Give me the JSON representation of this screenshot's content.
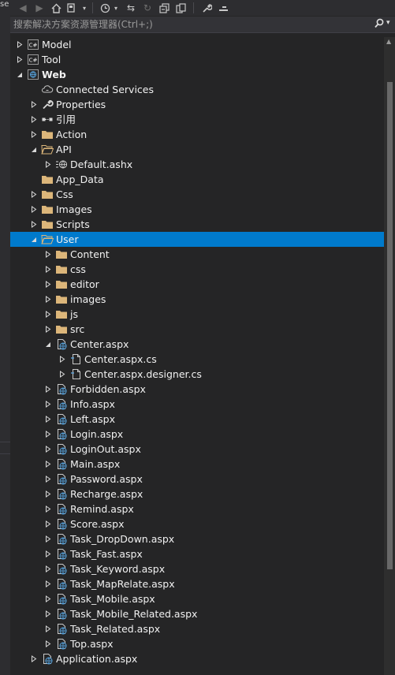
{
  "window": {
    "partial_title": "se"
  },
  "search": {
    "placeholder": "搜索解决方案资源管理器(Ctrl+;)"
  },
  "tree": [
    {
      "label": "Model",
      "depth": 0,
      "icon": "csharp-project",
      "expander": "collapsed",
      "bold": false,
      "selected": false
    },
    {
      "label": "Tool",
      "depth": 0,
      "icon": "csharp-project",
      "expander": "collapsed",
      "bold": false,
      "selected": false
    },
    {
      "label": "Web",
      "depth": 0,
      "icon": "web-project",
      "expander": "expanded",
      "bold": true,
      "selected": false
    },
    {
      "label": "Connected Services",
      "depth": 1,
      "icon": "connected-services",
      "expander": "none",
      "bold": false,
      "selected": false
    },
    {
      "label": "Properties",
      "depth": 1,
      "icon": "wrench",
      "expander": "collapsed",
      "bold": false,
      "selected": false
    },
    {
      "label": "引用",
      "depth": 1,
      "icon": "references",
      "expander": "collapsed",
      "bold": false,
      "selected": false
    },
    {
      "label": "Action",
      "depth": 1,
      "icon": "folder",
      "expander": "collapsed",
      "bold": false,
      "selected": false
    },
    {
      "label": "API",
      "depth": 1,
      "icon": "folder-open",
      "expander": "expanded",
      "bold": false,
      "selected": false
    },
    {
      "label": "Default.ashx",
      "depth": 2,
      "icon": "web-handler",
      "expander": "collapsed",
      "bold": false,
      "selected": false
    },
    {
      "label": "App_Data",
      "depth": 1,
      "icon": "folder",
      "expander": "none",
      "bold": false,
      "selected": false
    },
    {
      "label": "Css",
      "depth": 1,
      "icon": "folder",
      "expander": "collapsed",
      "bold": false,
      "selected": false
    },
    {
      "label": "Images",
      "depth": 1,
      "icon": "folder",
      "expander": "collapsed",
      "bold": false,
      "selected": false
    },
    {
      "label": "Scripts",
      "depth": 1,
      "icon": "folder",
      "expander": "collapsed",
      "bold": false,
      "selected": false
    },
    {
      "label": "User",
      "depth": 1,
      "icon": "folder-open",
      "expander": "expanded",
      "bold": false,
      "selected": true
    },
    {
      "label": "Content",
      "depth": 2,
      "icon": "folder",
      "expander": "collapsed",
      "bold": false,
      "selected": false
    },
    {
      "label": "css",
      "depth": 2,
      "icon": "folder",
      "expander": "collapsed",
      "bold": false,
      "selected": false
    },
    {
      "label": "editor",
      "depth": 2,
      "icon": "folder",
      "expander": "collapsed",
      "bold": false,
      "selected": false
    },
    {
      "label": "images",
      "depth": 2,
      "icon": "folder",
      "expander": "collapsed",
      "bold": false,
      "selected": false
    },
    {
      "label": "js",
      "depth": 2,
      "icon": "folder",
      "expander": "collapsed",
      "bold": false,
      "selected": false
    },
    {
      "label": "src",
      "depth": 2,
      "icon": "folder",
      "expander": "collapsed",
      "bold": false,
      "selected": false
    },
    {
      "label": "Center.aspx",
      "depth": 2,
      "icon": "aspx-page",
      "expander": "expanded",
      "bold": false,
      "selected": false
    },
    {
      "label": "Center.aspx.cs",
      "depth": 3,
      "icon": "code-file",
      "expander": "collapsed",
      "bold": false,
      "selected": false
    },
    {
      "label": "Center.aspx.designer.cs",
      "depth": 3,
      "icon": "code-file",
      "expander": "collapsed",
      "bold": false,
      "selected": false
    },
    {
      "label": "Forbidden.aspx",
      "depth": 2,
      "icon": "aspx-page",
      "expander": "collapsed",
      "bold": false,
      "selected": false
    },
    {
      "label": "Info.aspx",
      "depth": 2,
      "icon": "aspx-page",
      "expander": "collapsed",
      "bold": false,
      "selected": false
    },
    {
      "label": "Left.aspx",
      "depth": 2,
      "icon": "aspx-page",
      "expander": "collapsed",
      "bold": false,
      "selected": false
    },
    {
      "label": "Login.aspx",
      "depth": 2,
      "icon": "aspx-page",
      "expander": "collapsed",
      "bold": false,
      "selected": false
    },
    {
      "label": "LoginOut.aspx",
      "depth": 2,
      "icon": "aspx-page",
      "expander": "collapsed",
      "bold": false,
      "selected": false
    },
    {
      "label": "Main.aspx",
      "depth": 2,
      "icon": "aspx-page",
      "expander": "collapsed",
      "bold": false,
      "selected": false
    },
    {
      "label": "Password.aspx",
      "depth": 2,
      "icon": "aspx-page",
      "expander": "collapsed",
      "bold": false,
      "selected": false
    },
    {
      "label": "Recharge.aspx",
      "depth": 2,
      "icon": "aspx-page",
      "expander": "collapsed",
      "bold": false,
      "selected": false
    },
    {
      "label": "Remind.aspx",
      "depth": 2,
      "icon": "aspx-page",
      "expander": "collapsed",
      "bold": false,
      "selected": false
    },
    {
      "label": "Score.aspx",
      "depth": 2,
      "icon": "aspx-page",
      "expander": "collapsed",
      "bold": false,
      "selected": false
    },
    {
      "label": "Task_DropDown.aspx",
      "depth": 2,
      "icon": "aspx-page",
      "expander": "collapsed",
      "bold": false,
      "selected": false
    },
    {
      "label": "Task_Fast.aspx",
      "depth": 2,
      "icon": "aspx-page",
      "expander": "collapsed",
      "bold": false,
      "selected": false
    },
    {
      "label": "Task_Keyword.aspx",
      "depth": 2,
      "icon": "aspx-page",
      "expander": "collapsed",
      "bold": false,
      "selected": false
    },
    {
      "label": "Task_MapRelate.aspx",
      "depth": 2,
      "icon": "aspx-page",
      "expander": "collapsed",
      "bold": false,
      "selected": false
    },
    {
      "label": "Task_Mobile.aspx",
      "depth": 2,
      "icon": "aspx-page",
      "expander": "collapsed",
      "bold": false,
      "selected": false
    },
    {
      "label": "Task_Mobile_Related.aspx",
      "depth": 2,
      "icon": "aspx-page",
      "expander": "collapsed",
      "bold": false,
      "selected": false
    },
    {
      "label": "Task_Related.aspx",
      "depth": 2,
      "icon": "aspx-page",
      "expander": "collapsed",
      "bold": false,
      "selected": false
    },
    {
      "label": "Top.aspx",
      "depth": 2,
      "icon": "aspx-page",
      "expander": "collapsed",
      "bold": false,
      "selected": false
    },
    {
      "label": "Application.aspx",
      "depth": 1,
      "icon": "aspx-page",
      "expander": "collapsed",
      "bold": false,
      "selected": false
    }
  ],
  "colors": {
    "background": "#252526",
    "selection": "#007acc",
    "folder": "#dcb67a",
    "text": "#f1f1f1"
  }
}
